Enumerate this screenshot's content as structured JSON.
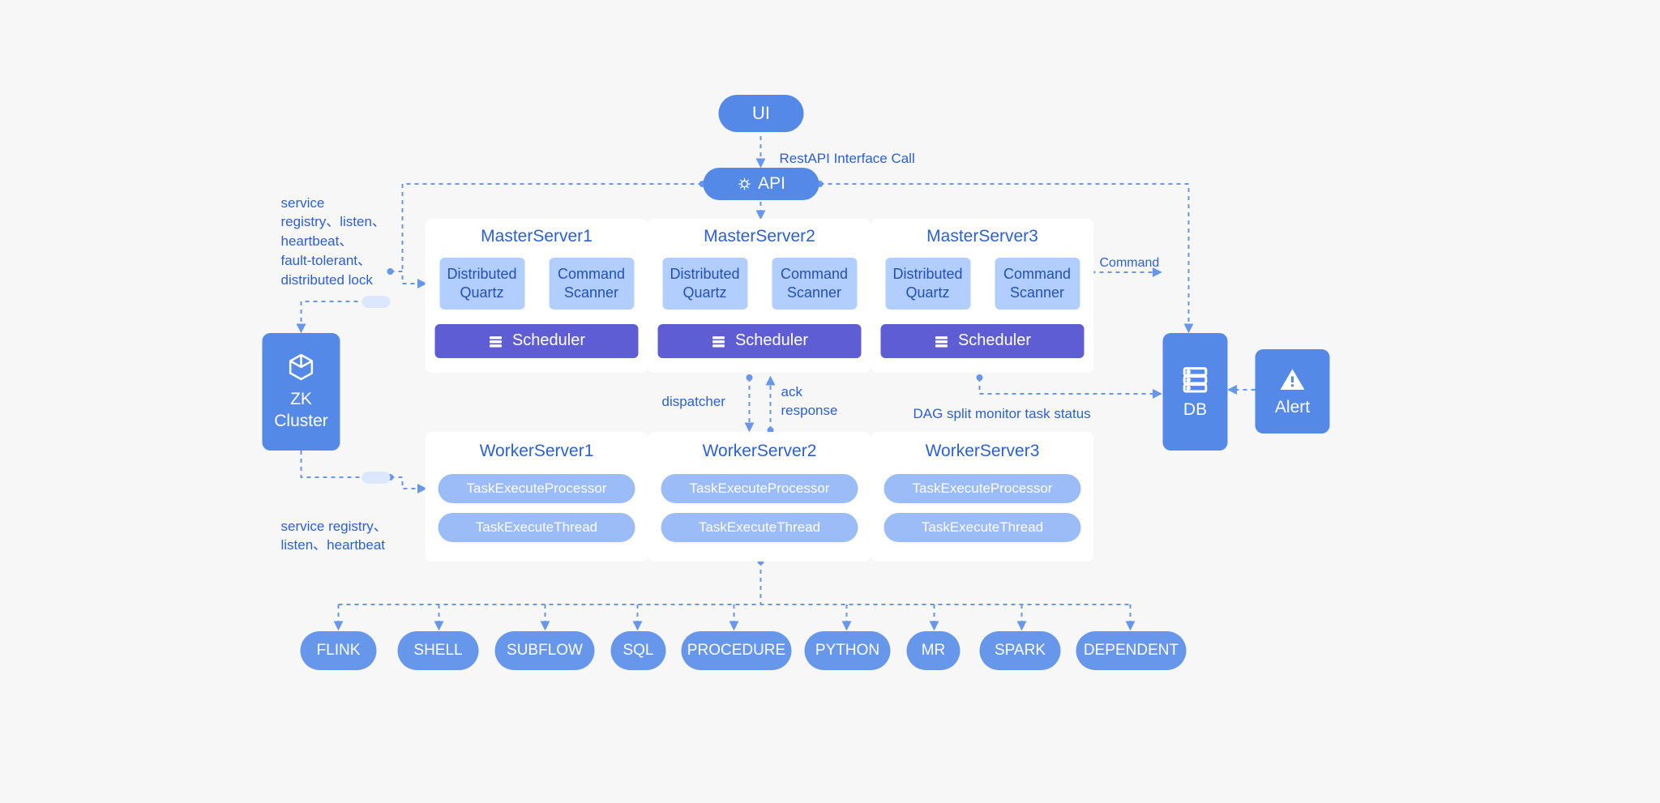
{
  "top": {
    "ui": "UI",
    "api": "API",
    "restapi": "RestAPI Interface Call"
  },
  "zk": {
    "title": "ZK\nCluster",
    "note1": "service\nregistry、listen、\nheartbeat、\nfault-tolerant、\ndistributed lock",
    "note2": "service registry、\nlisten、heartbeat"
  },
  "masters": {
    "m1": "MasterServer1",
    "m2": "MasterServer2",
    "m3": "MasterServer3",
    "dq1": "Distributed",
    "dq2": "Quartz",
    "cs1": "Command",
    "cs2": "Scanner",
    "sched": "Scheduler"
  },
  "midlabels": {
    "dispatcher": "dispatcher",
    "ack": "ack\nresponse",
    "dag": "DAG split monitor task status",
    "command": "Command"
  },
  "workers": {
    "w1": "WorkerServer1",
    "w2": "WorkerServer2",
    "w3": "WorkerServer3",
    "tep": "TaskExecuteProcessor",
    "tet": "TaskExecuteThread"
  },
  "right": {
    "db": "DB",
    "alert": "Alert"
  },
  "tasks": [
    "FLINK",
    "SHELL",
    "SUBFLOW",
    "SQL",
    "PROCEDURE",
    "PYTHON",
    "MR",
    "SPARK",
    "DEPENDENT"
  ]
}
